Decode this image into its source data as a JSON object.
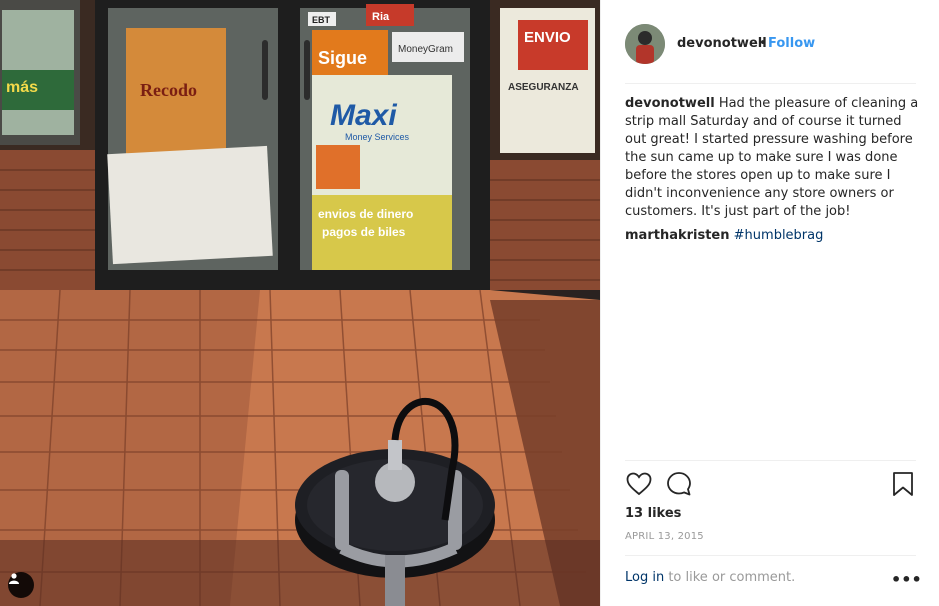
{
  "post": {
    "username": "devonotwell",
    "separator": "•",
    "follow_label": "Follow",
    "caption_user": "devonotwell",
    "caption_text": "Had the pleasure of cleaning a strip mall Saturday and of course it turned out great! I started pressure washing before the sun came up to make sure I was done before the stores open up to make sure I didn't inconvenience any store owners or customers. It's just part of the job!",
    "comment": {
      "user": "marthakristen",
      "text": "#humblebrag"
    },
    "likes": "13 likes",
    "date": "APRIL 13, 2015",
    "login_link": "Log in",
    "login_suffix": " to like or comment.",
    "more_label": "•••"
  },
  "photo_signs": {
    "sigue": "Sigue",
    "maxi": "Maxi",
    "maxi_sub": "Money Services",
    "envios1": "envios de dinero",
    "envios2": "pagos de biles",
    "moneygram": "MoneyGram",
    "envio": "ENVIO",
    "aseguranza": "ASEGURANZA",
    "mas": "más",
    "recodo": "Recodo",
    "ebt": "EBT",
    "ria": "Ria"
  },
  "icons": {
    "heart": "heart-icon",
    "comment": "comment-icon",
    "bookmark": "bookmark-icon",
    "tag": "user-tag-icon"
  },
  "colors": {
    "link": "#3897f0",
    "hashtag": "#003569",
    "text": "#262626",
    "muted": "#999999"
  }
}
